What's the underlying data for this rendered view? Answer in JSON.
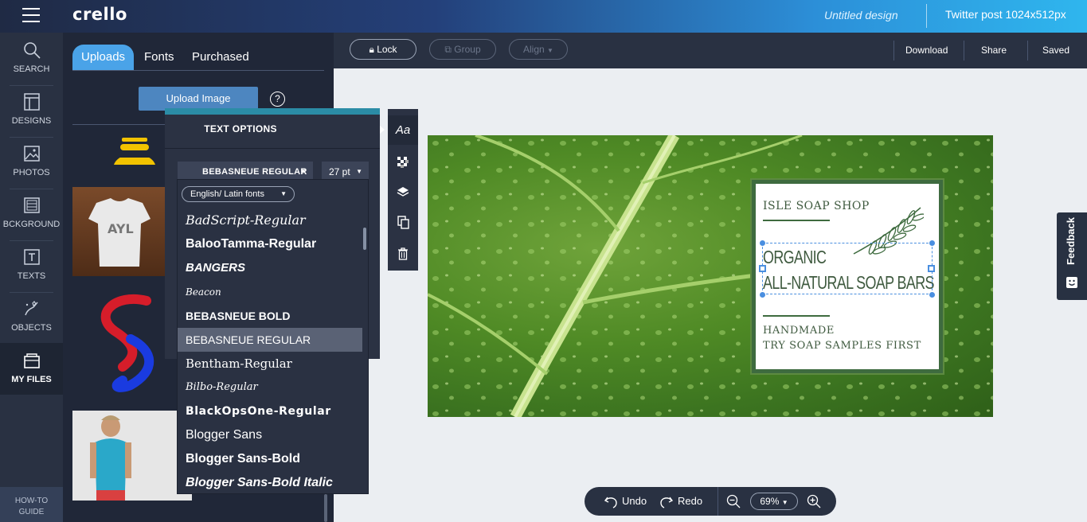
{
  "header": {
    "logo": "crello",
    "design_title": "Untitled design",
    "design_size": "Twitter post 1024x512px"
  },
  "nav": {
    "items": [
      {
        "label": "SEARCH",
        "icon": "search-icon"
      },
      {
        "label": "DESIGNS",
        "icon": "designs-icon"
      },
      {
        "label": "PHOTOS",
        "icon": "photos-icon"
      },
      {
        "label": "BCKGROUND",
        "icon": "background-icon"
      },
      {
        "label": "TEXTS",
        "icon": "texts-icon"
      },
      {
        "label": "OBJECTS",
        "icon": "objects-icon"
      },
      {
        "label": "MY FILES",
        "icon": "folder-icon"
      }
    ],
    "active": "MY FILES",
    "howto_line1": "HOW-TO",
    "howto_line2": "GUIDE"
  },
  "panel": {
    "tabs": [
      "Uploads",
      "Fonts",
      "Purchased"
    ],
    "active_tab": "Uploads",
    "upload_label": "Upload Image",
    "help_label": "?"
  },
  "text_options": {
    "title": "TEXT OPTIONS",
    "font": "BEBASNEUE REGULAR",
    "size": "27 pt",
    "language": "English/ Latin fonts",
    "fonts": [
      "BadScript-Regular",
      "BalooTamma-Regular",
      "BANGERS",
      "Beacon",
      "BEBASNEUE BOLD",
      "BEBASNEUE REGULAR",
      "Bentham-Regular",
      "Bilbo-Regular",
      "BlackOpsOne-Regular",
      "Blogger Sans",
      "Blogger Sans-Bold",
      "Blogger Sans-Bold Italic"
    ],
    "selected_font": "BEBASNEUE REGULAR",
    "tool_aa": "Aa"
  },
  "toolbar": {
    "lock": "Lock",
    "group": "Group",
    "align": "Align",
    "download": "Download",
    "share": "Share",
    "saved": "Saved"
  },
  "card": {
    "shop": "ISLE SOAP SHOP",
    "line1": "ORGANIC",
    "line2": "ALL-NATURAL SOAP BARS",
    "handmade": "HANDMADE",
    "try": "TRY SOAP SAMPLES FIRST",
    "border_color": "#3e6b3f"
  },
  "feedback": "Feedback",
  "bottom": {
    "undo": "Undo",
    "redo": "Redo",
    "zoom": "69%"
  },
  "colors": {
    "accent": "#4aa3e8",
    "nav_bg": "#293142",
    "panel_bg": "#202738"
  }
}
